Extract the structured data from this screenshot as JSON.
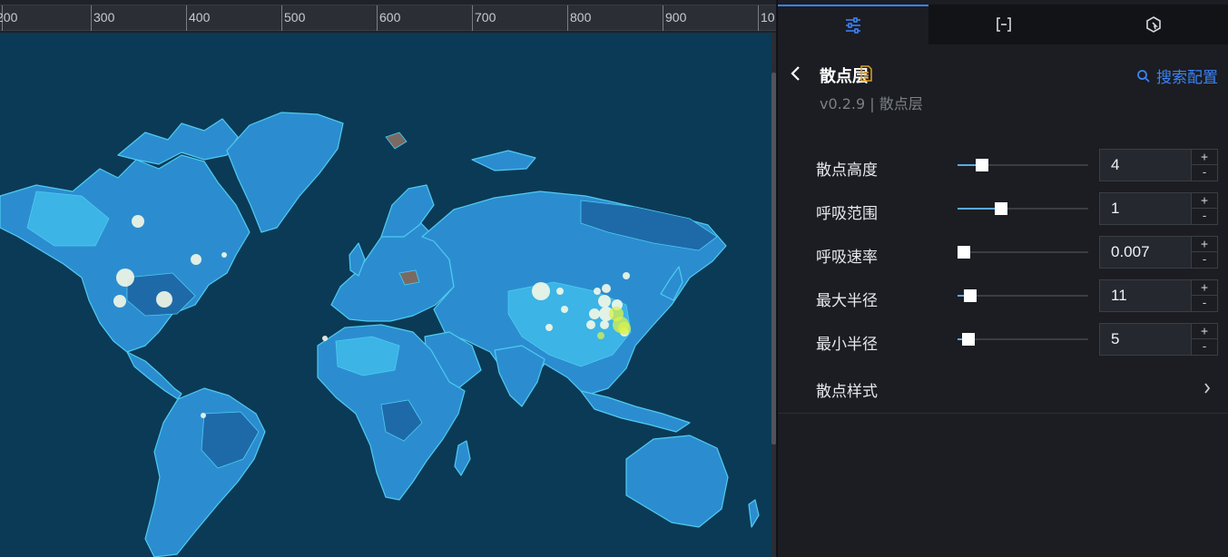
{
  "ruler": {
    "labels": [
      "200",
      "300",
      "400",
      "500",
      "600",
      "700",
      "800",
      "900",
      "10"
    ]
  },
  "map": {
    "land_color": "#2b8dd0",
    "ocean_color": "#0b3a56",
    "border_color": "#4ecbf0",
    "point_color": "#f4f8e6",
    "hot_point_color": "#d9f24a"
  },
  "tabs": [
    {
      "name": "style-tab",
      "icon": "sliders-icon",
      "active": true
    },
    {
      "name": "data-tab",
      "icon": "brackets-icon",
      "active": false
    },
    {
      "name": "interaction-tab",
      "icon": "interaction-icon",
      "active": false
    }
  ],
  "panel": {
    "title": "散点层",
    "subtitle": "v0.2.9 | 散点层",
    "search_label": "搜索配置",
    "accent_color": "#3b82f6"
  },
  "properties": [
    {
      "label": "散点高度",
      "value": "4",
      "slider": 0.19
    },
    {
      "label": "呼吸范围",
      "value": "1",
      "slider": 0.33
    },
    {
      "label": "呼吸速率",
      "value": "0.007",
      "slider": 0.04
    },
    {
      "label": "最大半径",
      "value": "11",
      "slider": 0.1
    },
    {
      "label": "最小半径",
      "value": "5",
      "slider": 0.08
    }
  ],
  "stepper": {
    "plus": "+",
    "minus": "-"
  },
  "style_section": {
    "label": "散点样式"
  }
}
